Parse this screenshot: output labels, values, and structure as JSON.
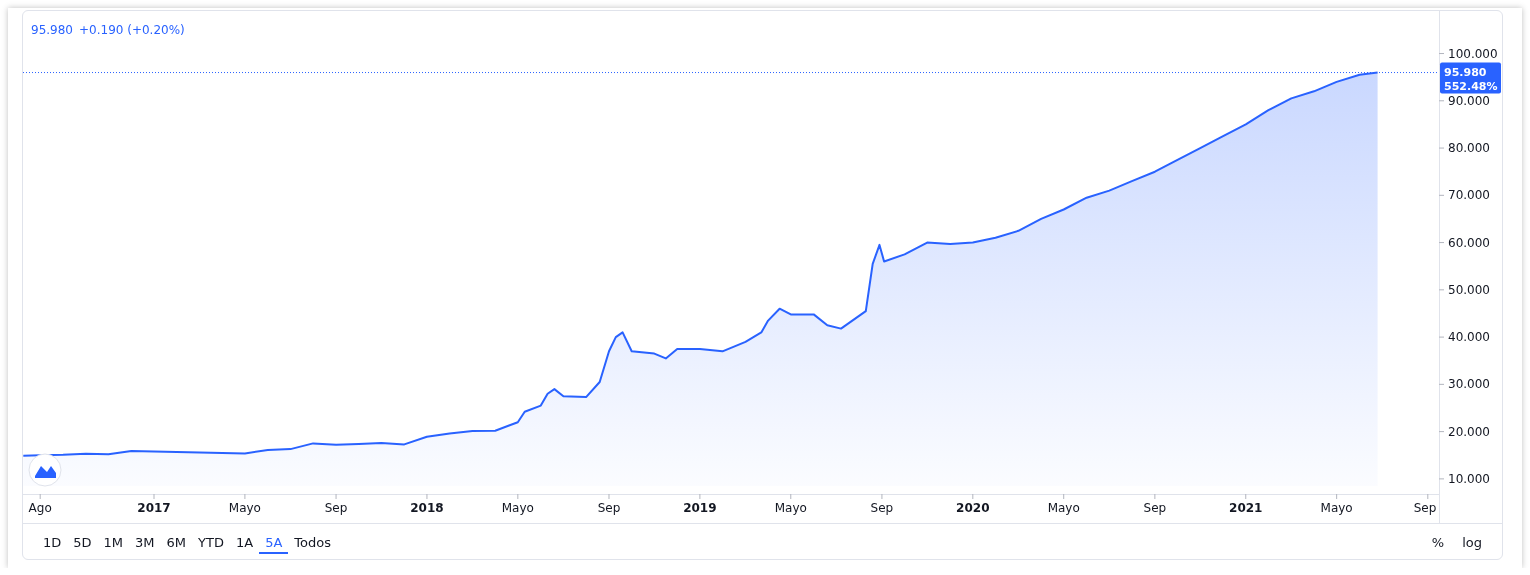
{
  "legend": {
    "price": "95.980",
    "change": "+0.190 (+0.20%)"
  },
  "chart": {
    "chart_data": {
      "type": "area",
      "x": [
        2016.521,
        2016.583,
        2016.667,
        2016.75,
        2016.833,
        2016.917,
        2017.0,
        2017.083,
        2017.167,
        2017.25,
        2017.333,
        2017.417,
        2017.5,
        2017.583,
        2017.667,
        2017.75,
        2017.833,
        2017.917,
        2018.0,
        2018.083,
        2018.167,
        2018.25,
        2018.333,
        2018.358,
        2018.417,
        2018.442,
        2018.467,
        2018.5,
        2018.583,
        2018.633,
        2018.667,
        2018.692,
        2018.717,
        2018.75,
        2018.833,
        2018.875,
        2018.917,
        2019.0,
        2019.083,
        2019.167,
        2019.225,
        2019.25,
        2019.292,
        2019.333,
        2019.417,
        2019.467,
        2019.517,
        2019.608,
        2019.633,
        2019.658,
        2019.675,
        2019.75,
        2019.833,
        2019.917,
        2020.0,
        2020.083,
        2020.167,
        2020.25,
        2020.333,
        2020.417,
        2020.5,
        2020.583,
        2020.667,
        2020.75,
        2020.833,
        2020.917,
        2021.0,
        2021.083,
        2021.167,
        2021.25,
        2021.333,
        2021.417,
        2021.483
      ],
      "series": [
        {
          "color": "#2962ff",
          "values": [
            14.9,
            15.0,
            15.1,
            15.3,
            15.2,
            15.9,
            15.8,
            15.7,
            15.6,
            15.5,
            15.4,
            16.1,
            16.3,
            17.5,
            17.2,
            17.4,
            17.6,
            17.3,
            18.9,
            19.6,
            20.1,
            20.2,
            22.0,
            24.2,
            25.5,
            28.0,
            29.0,
            27.5,
            27.3,
            30.5,
            37.0,
            40.0,
            41.0,
            37.0,
            36.5,
            35.5,
            37.5,
            37.5,
            37.0,
            39.0,
            41.0,
            43.5,
            46.0,
            44.8,
            44.8,
            42.5,
            41.8,
            45.5,
            55.5,
            59.5,
            56.0,
            57.5,
            60.0,
            59.7,
            60.0,
            61.0,
            62.5,
            65.0,
            67.0,
            69.5,
            71.0,
            73.0,
            75.0,
            77.5,
            80.0,
            82.5,
            85.0,
            88.0,
            90.5,
            92.0,
            94.0,
            95.5,
            95.98
          ]
        }
      ],
      "xlim": [
        2016.52,
        2021.708
      ],
      "ylim": [
        6.8,
        109
      ],
      "ref_lines": [
        {
          "axis": "y",
          "value": 95.98
        }
      ],
      "xticks": [
        {
          "value": 2016.583,
          "label": "Ago"
        },
        {
          "value": 2017,
          "label": "2017"
        },
        {
          "value": 2017.333,
          "label": "Mayo"
        },
        {
          "value": 2017.667,
          "label": "Sep"
        },
        {
          "value": 2018,
          "label": "2018"
        },
        {
          "value": 2018.333,
          "label": "Mayo"
        },
        {
          "value": 2018.667,
          "label": "Sep"
        },
        {
          "value": 2019,
          "label": "2019"
        },
        {
          "value": 2019.333,
          "label": "Mayo"
        },
        {
          "value": 2019.667,
          "label": "Sep"
        },
        {
          "value": 2020,
          "label": "2020"
        },
        {
          "value": 2020.333,
          "label": "Mayo"
        },
        {
          "value": 2020.667,
          "label": "Sep"
        },
        {
          "value": 2021,
          "label": "2021"
        },
        {
          "value": 2021.333,
          "label": "Mayo"
        },
        {
          "value": 2021.667,
          "label": "Sep"
        }
      ],
      "yticks": [
        {
          "value": 10,
          "label": "10.000"
        },
        {
          "value": 20,
          "label": "20.000"
        },
        {
          "value": 30,
          "label": "30.000"
        },
        {
          "value": 40,
          "label": "40.000"
        },
        {
          "value": 50,
          "label": "50.000"
        },
        {
          "value": 60,
          "label": "60.000"
        },
        {
          "value": 70,
          "label": "70.000"
        },
        {
          "value": 80,
          "label": "80.000"
        },
        {
          "value": 90,
          "label": "90.000"
        },
        {
          "value": 100,
          "label": "100.000"
        }
      ]
    }
  },
  "price_label": {
    "price": "95.980",
    "percent": "552.48%"
  },
  "ranges": [
    {
      "label": "1D",
      "selected": false
    },
    {
      "label": "5D",
      "selected": false
    },
    {
      "label": "1M",
      "selected": false
    },
    {
      "label": "3M",
      "selected": false
    },
    {
      "label": "6M",
      "selected": false
    },
    {
      "label": "YTD",
      "selected": false
    },
    {
      "label": "1A",
      "selected": false
    },
    {
      "label": "5A",
      "selected": true
    },
    {
      "label": "Todos",
      "selected": false
    }
  ],
  "scale_buttons": [
    "%",
    "log"
  ]
}
